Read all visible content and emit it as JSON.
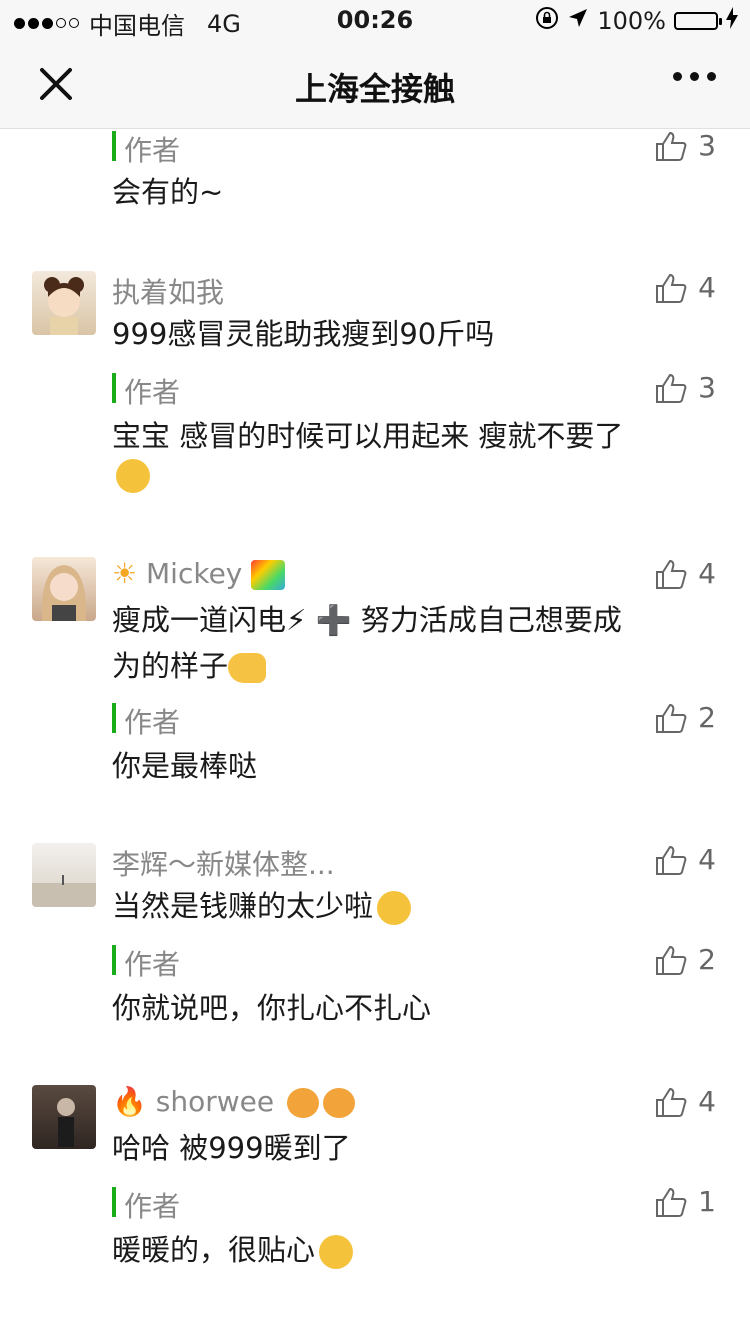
{
  "status": {
    "carrier": "中国电信",
    "network": "4G",
    "time": "00:26",
    "battery": "100%"
  },
  "nav": {
    "title": "上海全接触"
  },
  "comments": [
    {
      "reply_label": "作者",
      "reply_likes": "3",
      "reply_text": "会有的~"
    },
    {
      "name": "执着如我",
      "likes": "4",
      "text": "999感冒灵能助我瘦到90斤吗",
      "reply_label": "作者",
      "reply_likes": "3",
      "reply_text": "宝宝 感冒的时候可以用起来 瘦就不要了"
    },
    {
      "name": "Mickey",
      "likes": "4",
      "text_a": "瘦成一道闪电⚡ ➕ 努力活成自己想要成",
      "text_b": "为的样子",
      "reply_label": "作者",
      "reply_likes": "2",
      "reply_text": "你是最棒哒"
    },
    {
      "name": "李辉～新媒体整...",
      "likes": "4",
      "text": "当然是钱赚的太少啦",
      "reply_label": "作者",
      "reply_likes": "2",
      "reply_text": "你就说吧，你扎心不扎心"
    },
    {
      "name": "shorwee",
      "likes": "4",
      "text": "哈哈 被999暖到了",
      "reply_label": "作者",
      "reply_likes": "1",
      "reply_text": "暖暖的，很贴心"
    }
  ]
}
